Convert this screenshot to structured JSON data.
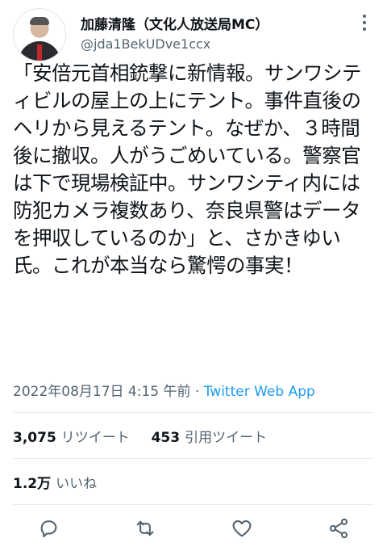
{
  "user": {
    "display_name": "加藤清隆（文化人放送局MC）",
    "handle": "@jda1BekUDve1ccx"
  },
  "tweet": {
    "text": "「安倍元首相銃撃に新情報。サンワシティビルの屋上の上にテント。事件直後のヘリから見えるテント。なぜか、３時間後に撤収。人がうごめいている。警察官は下で現場検証中。サンワシティ内には防犯カメラ複数あり、奈良県警はデータを押収しているのか」と、さかきゆい氏。これが本当なら驚愕の事実！",
    "timestamp": "2022年08月17日 4:15 午前",
    "separator": " · ",
    "source": "Twitter Web App"
  },
  "stats": {
    "retweets_count": "3,075",
    "retweets_label": "リツイート",
    "quotes_count": "453",
    "quotes_label": "引用ツイート",
    "likes_count": "1.2万",
    "likes_label": "いいね"
  },
  "icons": {
    "more": "more-vertical-icon",
    "reply": "reply-icon",
    "retweet": "retweet-icon",
    "like": "heart-icon",
    "share": "share-icon"
  },
  "colors": {
    "link": "#1d9bf0",
    "secondary_text": "#536471",
    "primary_text": "#0f1419"
  }
}
